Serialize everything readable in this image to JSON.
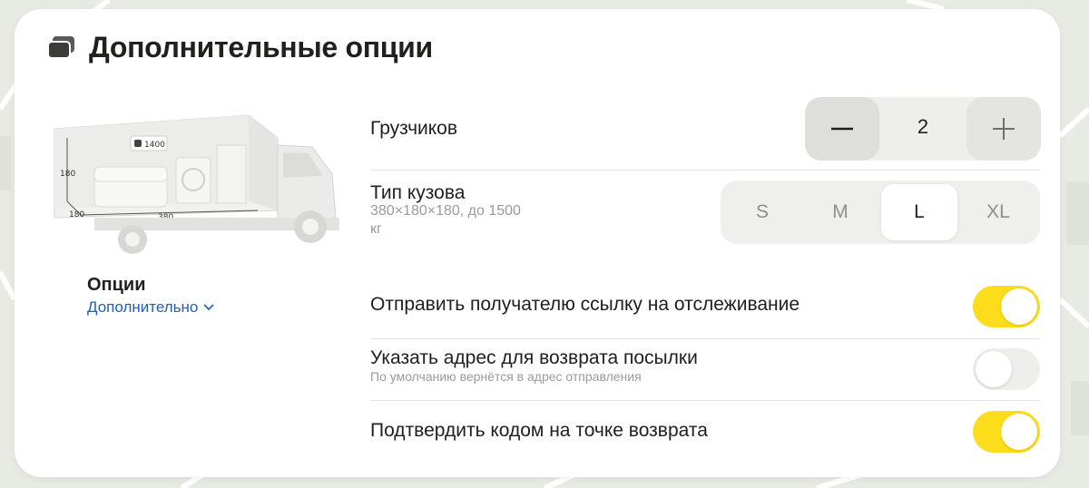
{
  "header": {
    "title": "Дополнительные опции",
    "icon": "cards-stack-icon"
  },
  "truck": {
    "weight_label": "1400",
    "height_label": "180",
    "depth_label": "180",
    "length_label": "380",
    "icon": "truck-image"
  },
  "options_panel": {
    "title": "Опции",
    "link": "Дополнительно",
    "link_icon": "chevron-down-icon"
  },
  "loaders": {
    "label": "Грузчиков",
    "value": "2",
    "minus_icon": "minus-icon",
    "plus_icon": "plus-icon"
  },
  "body_type": {
    "label": "Тип кузова",
    "details_line1": "380×180×180, до 1500",
    "details_line2": "кг",
    "options": [
      "S",
      "M",
      "L",
      "XL"
    ],
    "selected": "L"
  },
  "toggles": [
    {
      "label": "Отправить получателю ссылку на отслеживание",
      "sublabel": "",
      "on": true
    },
    {
      "label": "Указать адрес для возврата посылки",
      "sublabel": "По умолчанию вернётся в адрес отправления",
      "on": false
    },
    {
      "label": "Подтвердить кодом на точке возврата",
      "sublabel": "",
      "on": true
    }
  ],
  "colors": {
    "accent_toggle": "#fddd1b",
    "link": "#1f5fb8",
    "text": "#21201f",
    "muted": "#9b9a98"
  }
}
